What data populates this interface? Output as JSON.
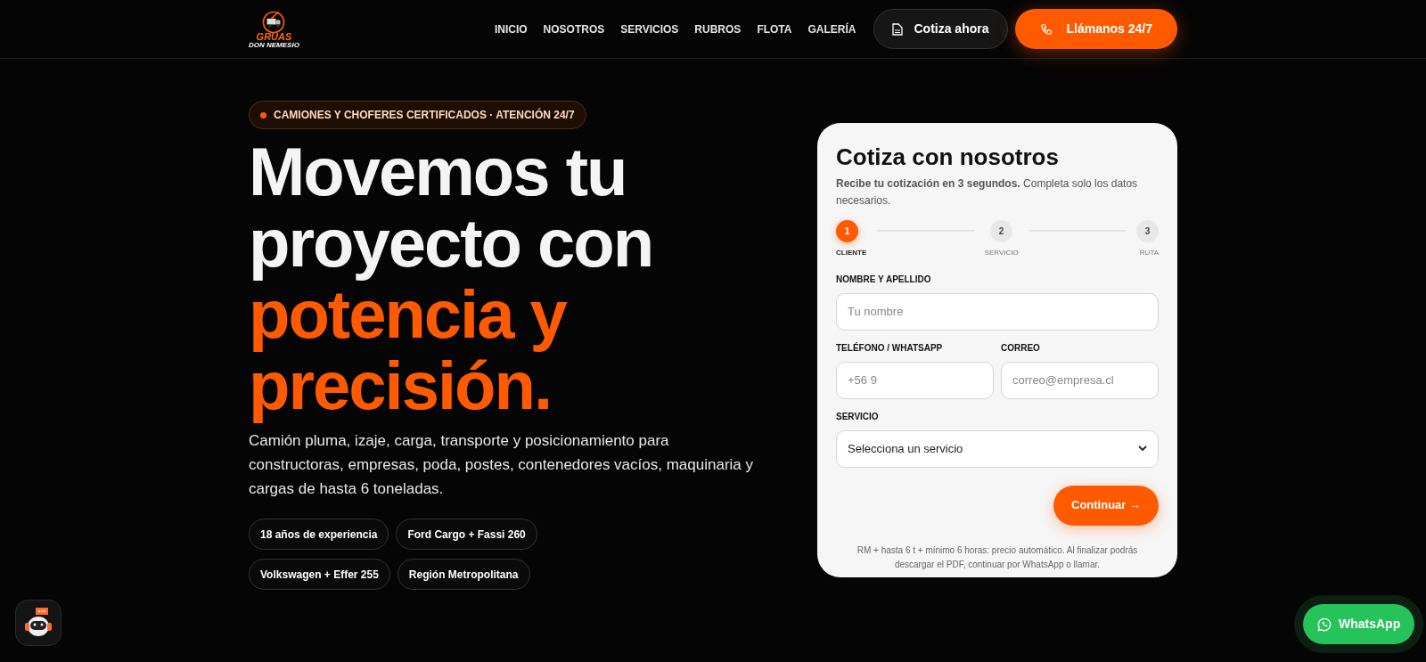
{
  "logo": {
    "line_1": "GRUAS",
    "line_2": "DON NEMESIO"
  },
  "nav": {
    "links": [
      "INICIO",
      "NOSOTROS",
      "SERVICIOS",
      "RUBROS",
      "FLOTA",
      "GALERÍA"
    ],
    "quote_button": "Cotiza ahora",
    "call_button": "Llámanos 24/7"
  },
  "hero": {
    "badge": "CAMIONES Y CHOFERES CERTIFICADOS · ATENCIÓN 24/7",
    "heading": "Movemos tu proyecto con",
    "heading_accent": "potencia y precisión.",
    "description": "Camión pluma, izaje, carga, transporte y posicionamiento para constructoras, empresas, poda, postes, contenedores vacíos, maquinaria y cargas de hasta 6 toneladas.",
    "chips": [
      "18 años de experiencia",
      "Ford Cargo + Fassi 260",
      "Volkswagen + Effer 255",
      "Región Metropolitana"
    ]
  },
  "form": {
    "title": "Cotiza con nosotros",
    "subtitle": "**Recibe tu cotización en 3 segundos.** Completa solo los datos necesarios.",
    "steps": [
      {
        "number": "1",
        "label": "CLIENTE",
        "selected": true
      },
      {
        "number": "2",
        "label": "SERVICIO",
        "selected": false
      },
      {
        "number": "3",
        "label": "RUTA",
        "selected": false
      }
    ],
    "name_field": {
      "label": "NOMBRE Y APELLIDO",
      "placeholder": "Tu nombre"
    },
    "phone_field": {
      "label": "TELÉFONO / WHATSAPP",
      "placeholder": "+56 9"
    },
    "email_field": {
      "label": "CORREO",
      "placeholder": "correo@empresa.cl"
    },
    "service_field": {
      "label": "SERVICIO",
      "value": "Selecciona un servicio"
    },
    "continue_button": "Continuar →",
    "note": "RM + hasta 6 t + mínimo 6 horas: precio automático. Al finalizar podrás descargar el PDF, continuar por WhatsApp o llamar."
  },
  "whatsapp_button": "WhatsApp"
}
